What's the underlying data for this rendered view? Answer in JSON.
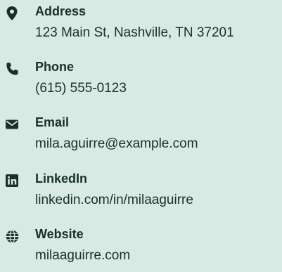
{
  "contact": {
    "items": [
      {
        "icon": "location-pin-icon",
        "label": "Address",
        "value": "123 Main St, Nashville, TN 37201"
      },
      {
        "icon": "phone-icon",
        "label": "Phone",
        "value": "(615) 555-0123"
      },
      {
        "icon": "envelope-icon",
        "label": "Email",
        "value": "mila.aguirre@example.com"
      },
      {
        "icon": "linkedin-icon",
        "label": "LinkedIn",
        "value": "linkedin.com/in/milaaguirre"
      },
      {
        "icon": "globe-icon",
        "label": "Website",
        "value": "milaaguirre.com"
      }
    ]
  },
  "colors": {
    "background": "#d9e9e3",
    "text": "#17312a"
  }
}
